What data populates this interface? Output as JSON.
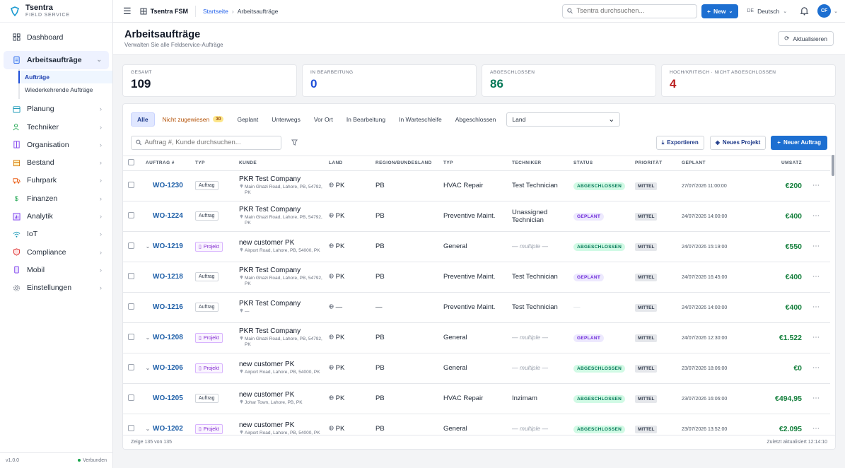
{
  "brand": {
    "name": "Tsentra",
    "sub": "FIELD SERVICE"
  },
  "sidebar": {
    "items": [
      {
        "label": "Dashboard",
        "icon": "grid-icon"
      },
      {
        "label": "Arbeitsaufträge",
        "icon": "clipboard-icon"
      },
      {
        "label": "Planung",
        "icon": "calendar-icon"
      },
      {
        "label": "Techniker",
        "icon": "user-icon"
      },
      {
        "label": "Organisation",
        "icon": "building-icon"
      },
      {
        "label": "Bestand",
        "icon": "box-icon"
      },
      {
        "label": "Fuhrpark",
        "icon": "truck-icon"
      },
      {
        "label": "Finanzen",
        "icon": "dollar-icon"
      },
      {
        "label": "Analytik",
        "icon": "chart-icon"
      },
      {
        "label": "IoT",
        "icon": "wifi-icon"
      },
      {
        "label": "Compliance",
        "icon": "shield-icon"
      },
      {
        "label": "Mobil",
        "icon": "phone-icon"
      },
      {
        "label": "Einstellungen",
        "icon": "gear-icon"
      }
    ],
    "sub": [
      "Aufträge",
      "Wiederkehrende Aufträge"
    ],
    "version": "v1.0.0",
    "status": "Verbunden"
  },
  "topbar": {
    "workspace": "Tsentra FSM",
    "crumb_home": "Startseite",
    "crumb_current": "Arbeitsaufträge",
    "search_placeholder": "Tsentra durchsuchen...",
    "new_label": "New",
    "lang_code": "DE",
    "lang": "Deutsch",
    "avatar": "CF"
  },
  "header": {
    "title": "Arbeitsaufträge",
    "subtitle": "Verwalten Sie alle Feldservice-Aufträge",
    "refresh": "Aktualisieren"
  },
  "stats": [
    {
      "label": "GESAMT",
      "value": "109",
      "color": "#111827"
    },
    {
      "label": "IN BEARBEITUNG",
      "value": "0",
      "color": "#1d4ed8"
    },
    {
      "label": "ABGESCHLOSSEN",
      "value": "86",
      "color": "#047857"
    },
    {
      "label": "HOCH/KRITISCH · NICHT ABGESCHLOSSEN",
      "value": "4",
      "color": "#b91c1c"
    }
  ],
  "tabs": [
    "Alle",
    "Nicht zugewiesen",
    "Geplant",
    "Unterwegs",
    "Vor Ort",
    "In Bearbeitung",
    "In Warteschleife",
    "Abgeschlossen"
  ],
  "tab_badge": "30",
  "land_select": "Land",
  "table_search_placeholder": "Auftrag #, Kunde durchsuchen...",
  "actions": {
    "export": "Exportieren",
    "new_project": "Neues Projekt",
    "new_order": "Neuer Auftrag"
  },
  "columns": [
    "AUFTRAG #",
    "TYP",
    "KUNDE",
    "LAND",
    "REGION/BUNDESLAND",
    "TYP",
    "TECHNIKER",
    "STATUS",
    "PRIORITÄT",
    "GEPLANT",
    "UMSATZ"
  ],
  "rows": [
    {
      "wo": "WO-1230",
      "exp": false,
      "typ": "Auftrag",
      "cust": "PKR Test Company",
      "addr": "Main Ghazi Road, Lahore, PB, 54792, PK",
      "land": "PK",
      "region": "PB",
      "jtype": "HVAC Repair",
      "tech": "Test Technician",
      "status": "ABGESCHLOSSEN",
      "pri": "MITTEL",
      "date": "27/07/2026 11:00:00",
      "amt": "€200"
    },
    {
      "wo": "WO-1224",
      "exp": false,
      "typ": "Auftrag",
      "cust": "PKR Test Company",
      "addr": "Main Ghazi Road, Lahore, PB, 54792, PK",
      "land": "PK",
      "region": "PB",
      "jtype": "Preventive Maint.",
      "tech": "Unassigned Technician",
      "status": "GEPLANT",
      "pri": "MITTEL",
      "date": "24/07/2026 14:00:00",
      "amt": "€400"
    },
    {
      "wo": "WO-1219",
      "exp": true,
      "typ": "Projekt",
      "cust": "new customer PK",
      "addr": "Airport Road, Lahore, PB, 54000, PK",
      "land": "PK",
      "region": "PB",
      "jtype": "General",
      "tech": "— multiple —",
      "status": "ABGESCHLOSSEN",
      "pri": "MITTEL",
      "date": "24/07/2026 15:19:00",
      "amt": "€550"
    },
    {
      "wo": "WO-1218",
      "exp": false,
      "typ": "Auftrag",
      "cust": "PKR Test Company",
      "addr": "Main Ghazi Road, Lahore, PB, 54792, PK",
      "land": "PK",
      "region": "PB",
      "jtype": "Preventive Maint.",
      "tech": "Test Technician",
      "status": "GEPLANT",
      "pri": "MITTEL",
      "date": "24/07/2026 16:45:00",
      "amt": "€400"
    },
    {
      "wo": "WO-1216",
      "exp": false,
      "typ": "Auftrag",
      "cust": "PKR Test Company",
      "addr": "—",
      "land": "—",
      "region": "—",
      "jtype": "Preventive Maint.",
      "tech": "Test Technician",
      "status": "—",
      "pri": "MITTEL",
      "date": "24/07/2026 14:00:00",
      "amt": "€400"
    },
    {
      "wo": "WO-1208",
      "exp": true,
      "typ": "Projekt",
      "cust": "PKR Test Company",
      "addr": "Main Ghazi Road, Lahore, PB, 54792, PK",
      "land": "PK",
      "region": "PB",
      "jtype": "General",
      "tech": "— multiple —",
      "status": "GEPLANT",
      "pri": "MITTEL",
      "date": "24/07/2026 12:30:00",
      "amt": "€1.522"
    },
    {
      "wo": "WO-1206",
      "exp": true,
      "typ": "Projekt",
      "cust": "new customer PK",
      "addr": "Airport Road, Lahore, PB, 54000, PK",
      "land": "PK",
      "region": "PB",
      "jtype": "General",
      "tech": "— multiple —",
      "status": "ABGESCHLOSSEN",
      "pri": "MITTEL",
      "date": "23/07/2026 18:06:00",
      "amt": "€0"
    },
    {
      "wo": "WO-1205",
      "exp": false,
      "typ": "Auftrag",
      "cust": "new customer PK",
      "addr": "Johar Town, Lahore, PB, PK",
      "land": "PK",
      "region": "PB",
      "jtype": "HVAC Repair",
      "tech": "Inzimam",
      "status": "ABGESCHLOSSEN",
      "pri": "MITTEL",
      "date": "23/07/2026 16:06:00",
      "amt": "€494,95"
    },
    {
      "wo": "WO-1202",
      "exp": true,
      "typ": "Projekt",
      "cust": "new customer PK",
      "addr": "Airport Road, Lahore, PB, 54000, PK",
      "land": "PK",
      "region": "PB",
      "jtype": "General",
      "tech": "— multiple —",
      "status": "ABGESCHLOSSEN",
      "pri": "MITTEL",
      "date": "23/07/2026 13:52:00",
      "amt": "€2.095"
    }
  ],
  "footer": {
    "count": "Zeige 135 von 135",
    "updated": "Zuletzt aktualisiert 12:14:10"
  }
}
